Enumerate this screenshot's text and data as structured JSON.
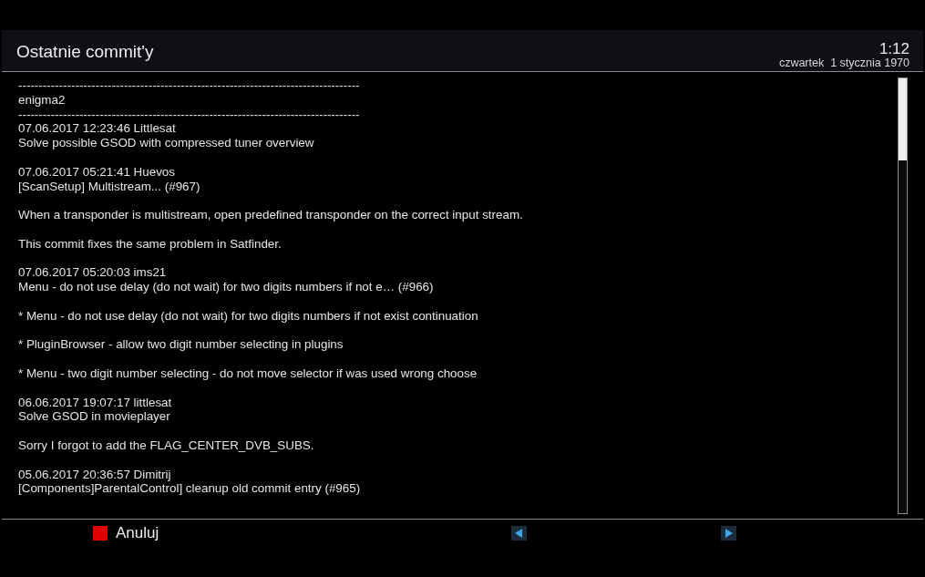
{
  "header": {
    "title": "Ostatnie commit'y",
    "time": "1:12",
    "date": "czwartek  1 stycznia 1970"
  },
  "log": {
    "paragraphs": [
      {
        "lines": [
          "------------------------------------------------------------------------------------",
          "enigma2",
          "------------------------------------------------------------------------------------",
          "07.06.2017 12:23:46 Littlesat",
          "Solve possible GSOD with compressed tuner overview"
        ]
      },
      {
        "lines": [
          "07.06.2017 05:21:41 Huevos",
          "[ScanSetup] Multistream... (#967)"
        ]
      },
      {
        "lines": [
          "When a transponder is multistream, open predefined transponder on the correct input stream."
        ]
      },
      {
        "lines": [
          "This commit fixes the same problem in Satfinder."
        ]
      },
      {
        "lines": [
          "07.06.2017 05:20:03 ims21",
          "Menu - do not use delay (do not wait) for two digits numbers if not e… (#966)"
        ]
      },
      {
        "lines": [
          "* Menu - do not use delay (do not wait) for two digits numbers if not exist continuation"
        ]
      },
      {
        "lines": [
          "* PluginBrowser - allow two digit number selecting in plugins"
        ]
      },
      {
        "lines": [
          "* Menu - two digit number selecting - do not move selector if was used wrong choose"
        ]
      },
      {
        "lines": [
          "06.06.2017 19:07:17 littlesat",
          "Solve GSOD in movieplayer"
        ]
      },
      {
        "lines": [
          "Sorry I forgot to add the FLAG_CENTER_DVB_SUBS."
        ]
      },
      {
        "lines": [
          "05.06.2017 20:36:57 Dimitrij",
          "[Components]ParentalControl] cleanup old commit entry (#965)"
        ]
      }
    ]
  },
  "footer": {
    "cancel_label": "Anuluj"
  }
}
